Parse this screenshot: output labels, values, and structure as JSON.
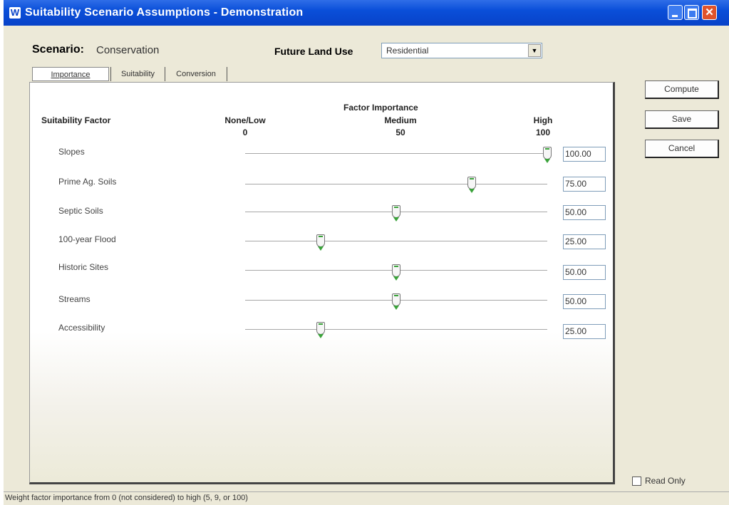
{
  "window": {
    "title": "Suitability Scenario Assumptions - Demonstration",
    "app_icon": "W"
  },
  "scenario": {
    "label": "Scenario:",
    "value": "Conservation"
  },
  "future_land_use": {
    "label": "Future Land Use",
    "selected": "Residential"
  },
  "tabs": [
    {
      "label": "Importance",
      "active": true
    },
    {
      "label": "Suitability",
      "active": false
    },
    {
      "label": "Conversion",
      "active": false
    }
  ],
  "header": {
    "factor_column": "Suitability Factor",
    "importance_title": "Factor Importance",
    "scale": [
      {
        "label": "None/Low",
        "value": "0"
      },
      {
        "label": "Medium",
        "value": "50"
      },
      {
        "label": "High",
        "value": "100"
      }
    ]
  },
  "factors": [
    {
      "label": "Slopes",
      "value": "100.00",
      "level": 100
    },
    {
      "label": "Prime Ag. Soils",
      "value": "75.00",
      "level": 75
    },
    {
      "label": "Septic Soils",
      "value": "50.00",
      "level": 50
    },
    {
      "label": "100-year Flood",
      "value": "25.00",
      "level": 25
    },
    {
      "label": "Historic Sites",
      "value": "50.00",
      "level": 50
    },
    {
      "label": "Streams",
      "value": "50.00",
      "level": 50
    },
    {
      "label": "Accessibility",
      "value": "25.00",
      "level": 25
    }
  ],
  "buttons": {
    "compute": "Compute",
    "save": "Save",
    "cancel": "Cancel"
  },
  "read_only": {
    "label": "Read Only",
    "checked": false
  },
  "status": "Weight factor importance from 0 (not considered) to high (5, 9, or 100)",
  "colors": {
    "titlebar": "#0842c8",
    "slider_mark": "#3aa23a",
    "close_button": "#e0532c"
  }
}
